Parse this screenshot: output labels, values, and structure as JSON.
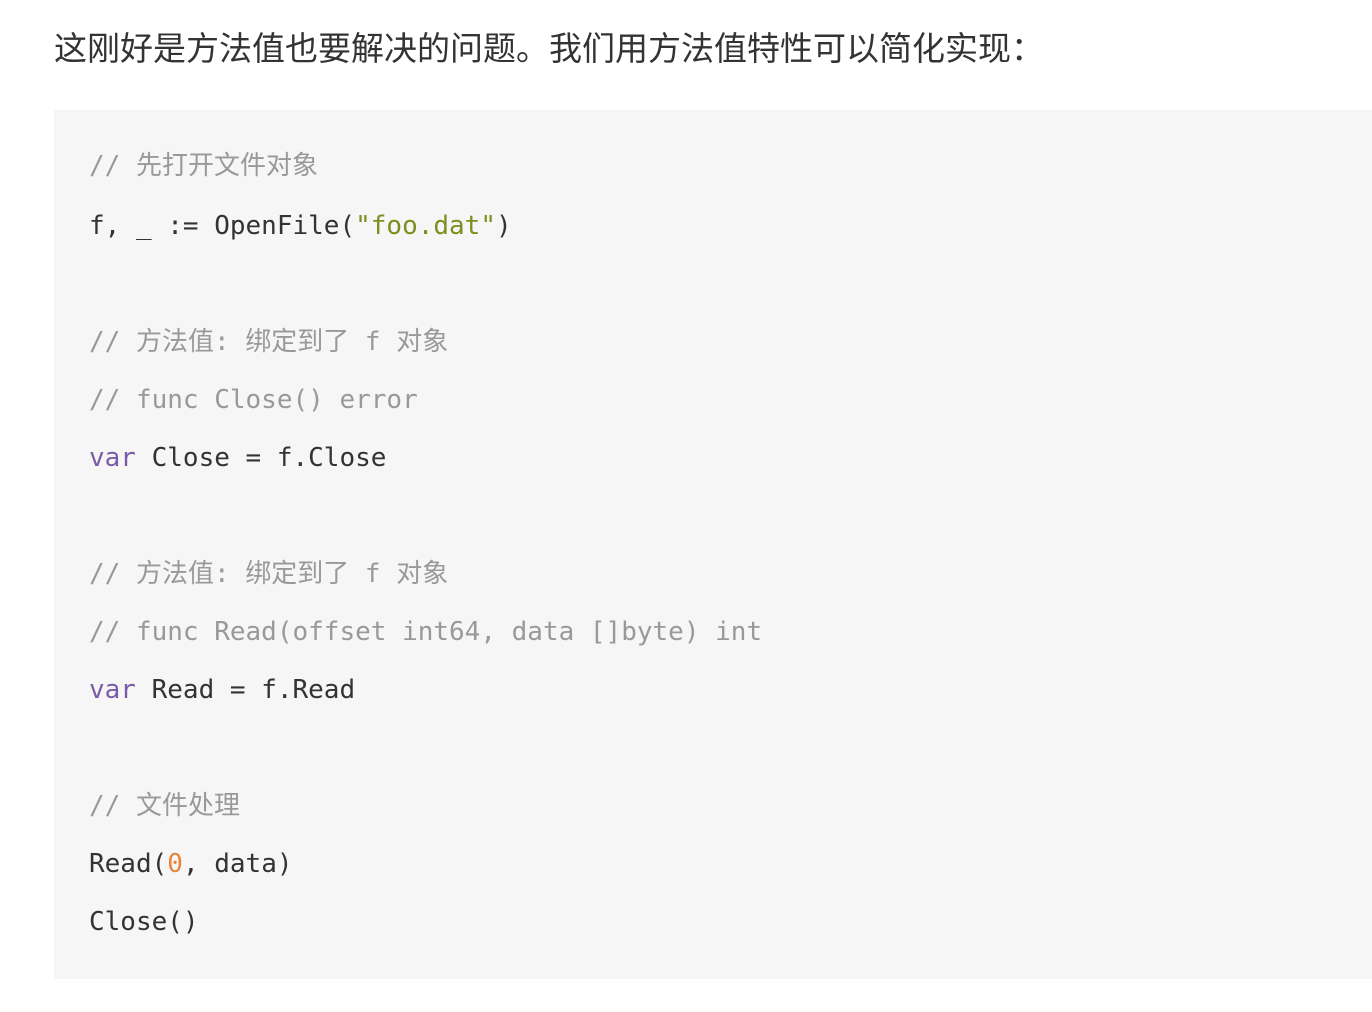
{
  "intro_text": "这刚好是方法值也要解决的问题。我们用方法值特性可以简化实现：",
  "code": {
    "lines": [
      [
        {
          "t": "// 先打开文件对象",
          "c": "comment"
        }
      ],
      [
        {
          "t": "f, _ := OpenFile(",
          "c": "plain"
        },
        {
          "t": "\"foo.dat\"",
          "c": "string"
        },
        {
          "t": ")",
          "c": "plain"
        }
      ],
      [],
      [
        {
          "t": "// 方法值: 绑定到了 f 对象",
          "c": "comment"
        }
      ],
      [
        {
          "t": "// func Close() error",
          "c": "comment"
        }
      ],
      [
        {
          "t": "var",
          "c": "keyword"
        },
        {
          "t": " Close = f.Close",
          "c": "plain"
        }
      ],
      [],
      [
        {
          "t": "// 方法值: 绑定到了 f 对象",
          "c": "comment"
        }
      ],
      [
        {
          "t": "// func Read(offset int64, data []byte) int",
          "c": "comment"
        }
      ],
      [
        {
          "t": "var",
          "c": "keyword"
        },
        {
          "t": " Read = f.Read",
          "c": "plain"
        }
      ],
      [],
      [
        {
          "t": "// 文件处理",
          "c": "comment"
        }
      ],
      [
        {
          "t": "Read(",
          "c": "plain"
        },
        {
          "t": "0",
          "c": "number"
        },
        {
          "t": ", data)",
          "c": "plain"
        }
      ],
      [
        {
          "t": "Close()",
          "c": "plain"
        }
      ]
    ]
  }
}
